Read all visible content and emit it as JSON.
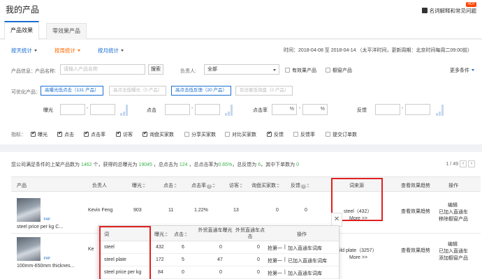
{
  "header": {
    "title": "我的产品",
    "help_link": "名词解释和常见问题",
    "hot_badge": "HOT"
  },
  "tabs": [
    {
      "label": "产品效果"
    },
    {
      "label": "零效果产品"
    }
  ],
  "stat_tabs": [
    {
      "label": "按天统计"
    },
    {
      "label": "按周统计"
    },
    {
      "label": "按月统计"
    }
  ],
  "time_info": "时间：2018-04-08 至 2018-04-14 （太平洋时间，更新周期：北京时间每周二09:00前）",
  "filters": {
    "product_info_label": "产品信息：",
    "product_name_label": "产品名称:",
    "product_name_placeholder": "请输入产品名称",
    "search_button": "搜索",
    "owner_label": "负责人:",
    "owner_value": "全部",
    "effective_products": "有效果产品",
    "showcase_products": "橱窗产品",
    "more_conditions": "更多条件"
  },
  "optimizable": {
    "label": "可优化产品：",
    "pills": [
      {
        "label": "高曝光低点击（131 产品）"
      },
      {
        "label": "高点击低曝光（0 产品）"
      },
      {
        "label": "高点击低反馈（20 产品）"
      },
      {
        "label": "有访客低询盘（0 产品）"
      }
    ]
  },
  "ranges": {
    "impressions": "曝光",
    "clicks": "点击",
    "ctr": "点击率",
    "ctr_unit": "%",
    "feedback": "反馈"
  },
  "indicators": {
    "label": "指标：",
    "items": [
      {
        "label": "曝光",
        "checked": true
      },
      {
        "label": "点击",
        "checked": true
      },
      {
        "label": "点击率",
        "checked": true
      },
      {
        "label": "访客",
        "checked": true
      },
      {
        "label": "询盘买家数",
        "checked": true
      },
      {
        "label": "分享买家数",
        "checked": false
      },
      {
        "label": "对比买家数",
        "checked": false
      },
      {
        "label": "反馈",
        "checked": true
      },
      {
        "label": "反馈率",
        "checked": false
      },
      {
        "label": "提交订单数",
        "checked": false
      }
    ]
  },
  "summary": {
    "p1": "您公司满足条件的上架产品数为",
    "products": "1462",
    "p2": "个，获得的总曝光为",
    "impressions": "19045",
    "p3": "，总点击为",
    "clicks": "124",
    "p4": "，总点击率为",
    "ctr": "0.65%",
    "p5": "，总反馈为",
    "feedback": "6",
    "p6": "，其中下单数为",
    "orders": "0"
  },
  "pager": "1 / 49",
  "table": {
    "headers": {
      "product": "产品",
      "owner": "负责人",
      "impressions": "曝光",
      "clicks": "点击",
      "ctr": "点击率",
      "visitors": "访客",
      "inquiry_buyers": "询盘买家数",
      "feedback": "反馈",
      "source_words": "词来源",
      "trend": "查看效果趋势",
      "actions": "操作"
    },
    "rows": [
      {
        "name": "steel price per kg C...",
        "owner": "Kevin Feng",
        "impressions": "903",
        "clicks": "11",
        "ctr": "1.22%",
        "visitors": "13",
        "inquiry": "0",
        "feedback": "0",
        "source": "steel（432）",
        "more": "More >>",
        "trend": "查看效果趋势",
        "actions": [
          "编辑",
          "已加入直通车",
          "移除橱窗产品"
        ]
      },
      {
        "name": "100mm-650mm thicknes...",
        "owner": "Ke",
        "source": "ild plate（3257）",
        "more": "More >>",
        "trend": "查看效果趋势",
        "actions": [
          "编辑",
          "已加入直通车",
          "添加橱窗产品"
        ]
      }
    ],
    "p4p": "P4P"
  },
  "popup": {
    "headers": {
      "word": "词",
      "impressions": "曝光",
      "clicks": "点击",
      "p4p_impressions": "外贸直通车曝光",
      "p4p_clicks": "外贸直通车点击",
      "actions": "操作"
    },
    "rows": [
      {
        "word": "steel",
        "impressions": "432",
        "clicks": "6",
        "p4p_imp": "0",
        "p4p_clk": "0",
        "a1": "抢第一",
        "a2": "加入直通车词库"
      },
      {
        "word": "steel plate",
        "impressions": "172",
        "clicks": "5",
        "p4p_imp": "47",
        "p4p_clk": "0",
        "a1": "抢第一",
        "a2": "已加入直通车词库"
      },
      {
        "word": "steel price per kg",
        "impressions": "84",
        "clicks": "0",
        "p4p_imp": "0",
        "p4p_clk": "0",
        "a1": "抢第一",
        "a2": "加入直通车词库"
      }
    ]
  },
  "icons": {
    "help": "book-icon",
    "close": "close-icon",
    "question": "question-icon",
    "sort": "sort-icon"
  },
  "colors": {
    "accent": "#1a6fcf",
    "highlight": "#ff6a00",
    "success": "#3bb34a",
    "annotation": "#e02020"
  }
}
